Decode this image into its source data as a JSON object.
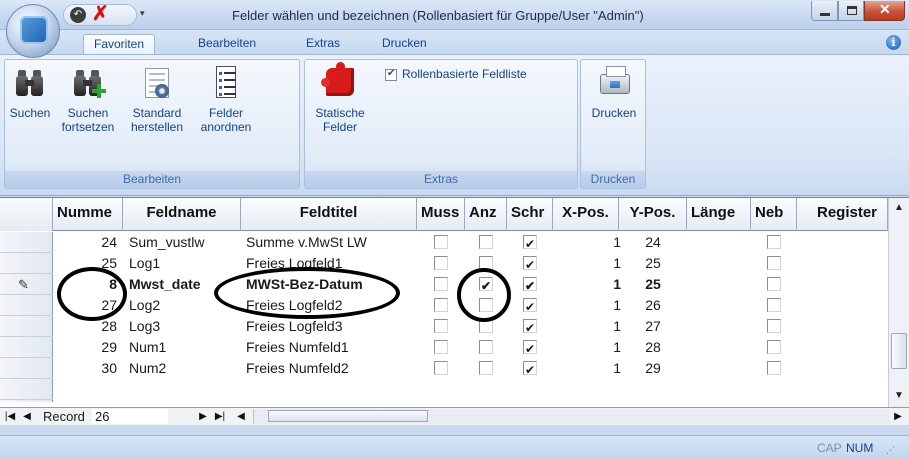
{
  "window": {
    "title": "Felder wählen und bezeichnen (Rollenbasiert für Gruppe/User \"Admin\")"
  },
  "tabs": [
    {
      "label": "Favoriten"
    },
    {
      "label": "Bearbeiten"
    },
    {
      "label": "Extras"
    },
    {
      "label": "Drucken"
    }
  ],
  "ribbon": {
    "bearbeiten": {
      "label": "Bearbeiten",
      "suchen": "Suchen",
      "suchen_fortsetzen_1": "Suchen",
      "suchen_fortsetzen_2": "fortsetzen",
      "standard_1": "Standard",
      "standard_2": "herstellen",
      "felder_1": "Felder",
      "felder_2": "anordnen"
    },
    "extras": {
      "label": "Extras",
      "statische_1": "Statische",
      "statische_2": "Felder",
      "rollenbasiert": "Rollenbasierte Feldliste",
      "rollenbasiert_checked": true
    },
    "drucken": {
      "label": "Drucken",
      "drucken": "Drucken"
    }
  },
  "grid": {
    "columns": [
      "Numme",
      "Feldname",
      "Feldtitel",
      "Muss",
      "Anz",
      "Schr",
      "X-Pos.",
      "Y-Pos.",
      "Länge",
      "Neb",
      "Register"
    ],
    "rows": [
      {
        "num": "24",
        "feldname": "Sum_vustlw",
        "feldtitel": "Summe v.MwSt LW",
        "muss": false,
        "anz": false,
        "schr": true,
        "x": "1",
        "y": "24",
        "laenge": "",
        "neb": false,
        "bold": false,
        "editing": false
      },
      {
        "num": "25",
        "feldname": "Log1",
        "feldtitel": "Freies Logfeld1",
        "muss": false,
        "anz": false,
        "schr": true,
        "x": "1",
        "y": "25",
        "laenge": "",
        "neb": false,
        "bold": false,
        "editing": false
      },
      {
        "num": "8",
        "feldname": "Mwst_date",
        "feldtitel": "MWSt-Bez-Datum",
        "muss": false,
        "anz": true,
        "schr": true,
        "x": "1",
        "y": "25",
        "laenge": "",
        "neb": false,
        "bold": true,
        "editing": true
      },
      {
        "num": "27",
        "feldname": "Log2",
        "feldtitel": "Freies Logfeld2",
        "muss": false,
        "anz": false,
        "schr": true,
        "x": "1",
        "y": "26",
        "laenge": "",
        "neb": false,
        "bold": false,
        "editing": false
      },
      {
        "num": "28",
        "feldname": "Log3",
        "feldtitel": "Freies Logfeld3",
        "muss": false,
        "anz": false,
        "schr": true,
        "x": "1",
        "y": "27",
        "laenge": "",
        "neb": false,
        "bold": false,
        "editing": false
      },
      {
        "num": "29",
        "feldname": "Num1",
        "feldtitel": "Freies Numfeld1",
        "muss": false,
        "anz": false,
        "schr": true,
        "x": "1",
        "y": "28",
        "laenge": "",
        "neb": false,
        "bold": false,
        "editing": false
      },
      {
        "num": "30",
        "feldname": "Num2",
        "feldtitel": "Freies Numfeld2",
        "muss": false,
        "anz": false,
        "schr": true,
        "x": "1",
        "y": "29",
        "laenge": "",
        "neb": false,
        "bold": false,
        "editing": false
      }
    ]
  },
  "navigator": {
    "record_label": "Record",
    "record_value": "26"
  },
  "status": {
    "cap": "CAP",
    "num": "NUM"
  },
  "icons": {
    "help": "i",
    "pencil": "✎"
  }
}
